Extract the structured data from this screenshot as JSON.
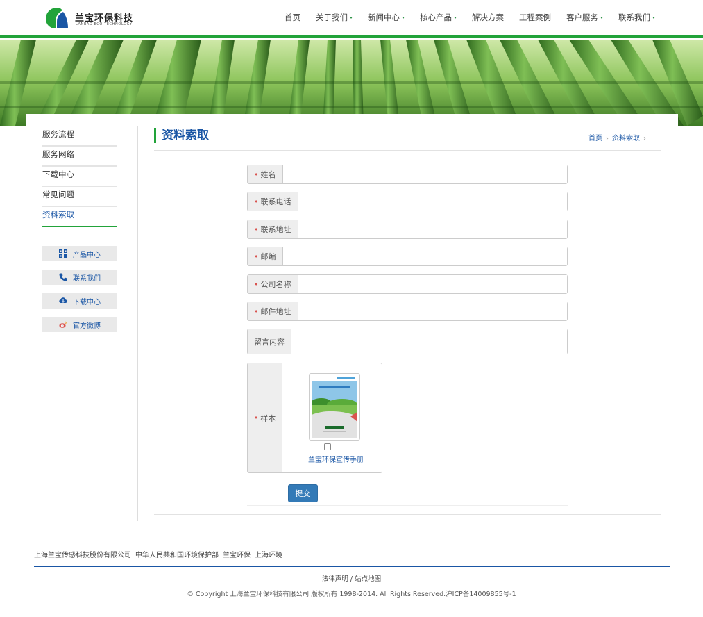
{
  "logo": {
    "name": "兰宝环保科技",
    "sub": "LANBAO ECO TECHNOLOGY"
  },
  "nav": [
    {
      "label": "首页",
      "dropdown": false
    },
    {
      "label": "关于我们",
      "dropdown": true
    },
    {
      "label": "新闻中心",
      "dropdown": true
    },
    {
      "label": "核心产品",
      "dropdown": true
    },
    {
      "label": "解决方案",
      "dropdown": false
    },
    {
      "label": "工程案例",
      "dropdown": false
    },
    {
      "label": "客户服务",
      "dropdown": true
    },
    {
      "label": "联系我们",
      "dropdown": true
    }
  ],
  "sidebar": {
    "links": [
      "服务流程",
      "服务网络",
      "下载中心",
      "常见问题",
      "资料索取"
    ],
    "active_index": 4,
    "buttons": [
      {
        "label": "产品中心",
        "icon": "grid-icon"
      },
      {
        "label": "联系我们",
        "icon": "phone-icon"
      },
      {
        "label": "下载中心",
        "icon": "cloud-download-icon"
      },
      {
        "label": "官方微博",
        "icon": "weibo-icon"
      }
    ]
  },
  "page": {
    "title": "资料索取",
    "breadcrumb": [
      "首页",
      "资料索取"
    ]
  },
  "form": {
    "fields": [
      {
        "label": "姓名",
        "required": true,
        "value": ""
      },
      {
        "label": "联系电话",
        "required": true,
        "value": ""
      },
      {
        "label": "联系地址",
        "required": true,
        "value": ""
      },
      {
        "label": "邮编",
        "required": true,
        "value": ""
      },
      {
        "label": "公司名称",
        "required": true,
        "value": ""
      },
      {
        "label": "邮件地址",
        "required": true,
        "value": ""
      }
    ],
    "message_label": "留言内容",
    "sample_label": "样本",
    "sample_title": "兰宝环保宣传手册",
    "sample_checked": false,
    "submit_label": "提交"
  },
  "footer": {
    "links": [
      "上海兰宝传感科技股份有限公司",
      "中华人民共和国环境保护部",
      "兰宝环保",
      "上海环境"
    ],
    "legal": "法律声明 / 站点地图",
    "copyright": "© Copyright 上海兰宝环保科技有限公司 版权所有 1998-2014. All Rights Reserved.沪ICP备14009855号-1"
  },
  "colors": {
    "accent_green": "#22a33a",
    "link_blue": "#1a56a5",
    "button_blue": "#337ab7"
  }
}
